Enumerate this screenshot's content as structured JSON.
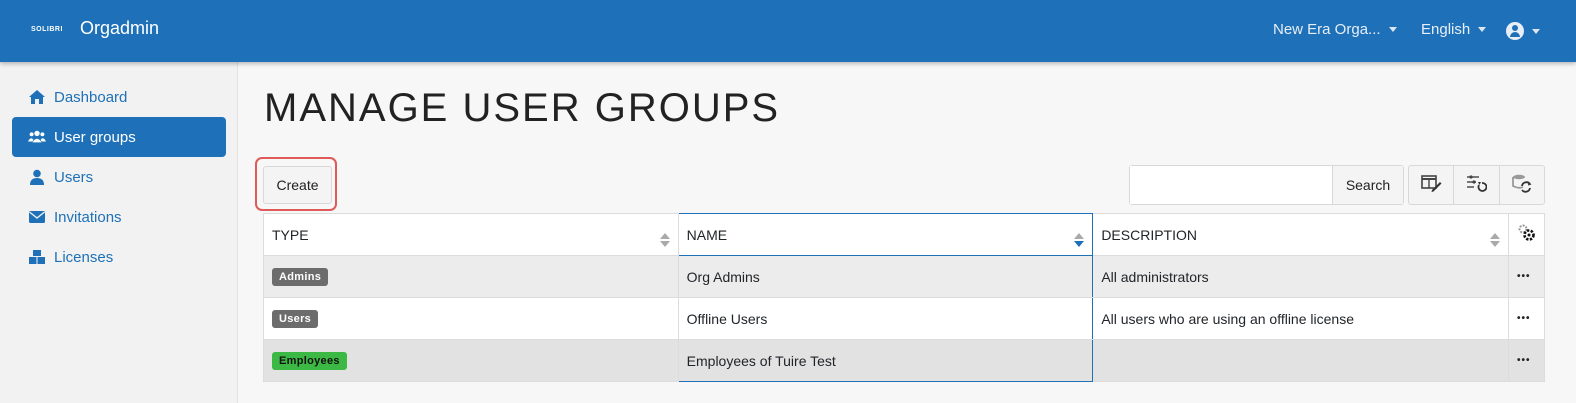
{
  "header": {
    "logo_text": "SOLIBRI",
    "title": "Orgadmin",
    "org_selector": "New Era Orga...",
    "language": "English",
    "user_icon": "user-circle-icon"
  },
  "sidebar": {
    "items": [
      {
        "label": "Dashboard",
        "icon": "home-icon",
        "active": false
      },
      {
        "label": "User groups",
        "icon": "users-icon",
        "active": true
      },
      {
        "label": "Users",
        "icon": "user-icon",
        "active": false
      },
      {
        "label": "Invitations",
        "icon": "envelope-icon",
        "active": false
      },
      {
        "label": "Licenses",
        "icon": "boxes-icon",
        "active": false
      }
    ]
  },
  "main": {
    "title": "MANAGE USER GROUPS",
    "create_label": "Create",
    "search": {
      "value": "",
      "placeholder": "",
      "button_label": "Search"
    },
    "tools": [
      "column-editor-icon",
      "reset-filters-icon",
      "refresh-data-icon"
    ]
  },
  "table": {
    "columns": [
      "TYPE",
      "NAME",
      "DESCRIPTION"
    ],
    "settings_icon": "gear-icon",
    "rows": [
      {
        "type": "Admins",
        "type_color": "#6c6c6c",
        "name": "Org Admins",
        "description": "All administrators",
        "menu": "..."
      },
      {
        "type": "Users",
        "type_color": "#6c6c6c",
        "name": "Offline Users",
        "description": "All users who are using an offline license",
        "menu": "..."
      },
      {
        "type": "Employees",
        "type_color": "#3cb844",
        "name": "Employees of Tuire Test",
        "description": "",
        "menu": "..."
      }
    ]
  },
  "colors": {
    "brand": "#1e71b8",
    "highlight": "#e05a5a"
  }
}
